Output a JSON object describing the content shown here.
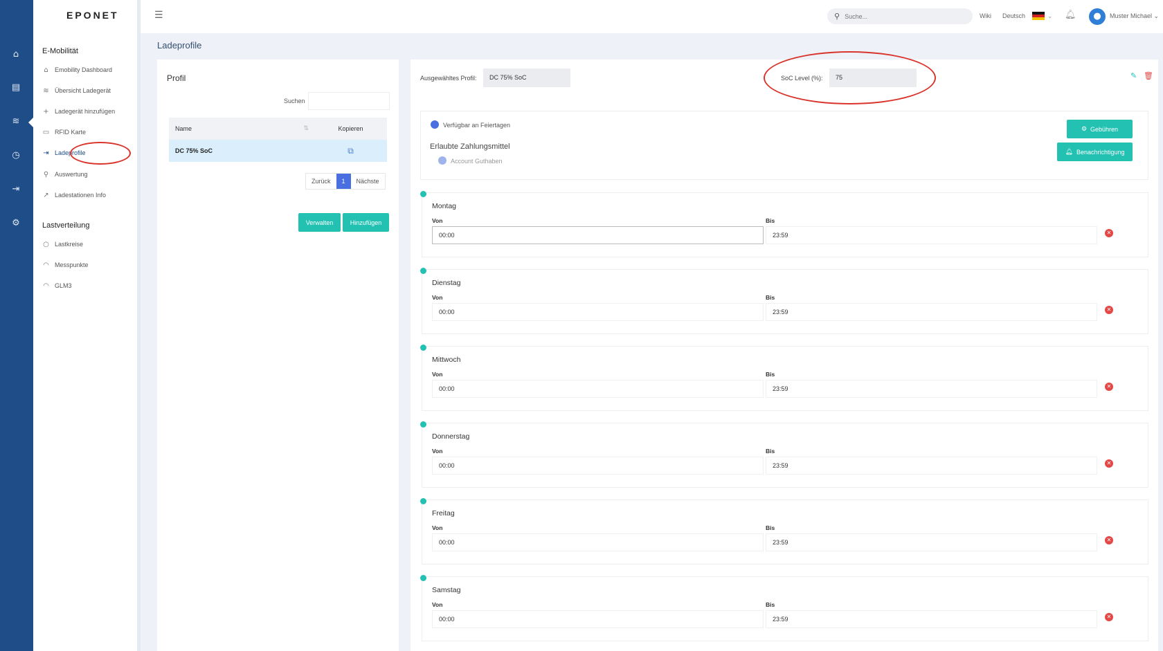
{
  "brand": "EPONET",
  "rail_icons": [
    "home-icon",
    "storage-icon",
    "waves-icon",
    "clock-icon",
    "login-icon",
    "gear-icon"
  ],
  "sidebar": {
    "sections": [
      {
        "title": "E-Mobilität",
        "items": [
          {
            "label": "Emobility Dashboard",
            "icon": "home-icon"
          },
          {
            "label": "Übersicht Ladegerät",
            "icon": "waves-icon"
          },
          {
            "label": "Ladegerät hinzufügen",
            "icon": "plus-icon"
          },
          {
            "label": "RFID Karte",
            "icon": "card-icon"
          },
          {
            "label": "Ladeprofile",
            "icon": "login-icon"
          },
          {
            "label": "Auswertung",
            "icon": "search-icon"
          },
          {
            "label": "Ladestationen Info",
            "icon": "chart-line-icon"
          }
        ]
      },
      {
        "title": "Lastverteilung",
        "items": [
          {
            "label": "Lastkreise",
            "icon": "circle-icon"
          },
          {
            "label": "Messpunkte",
            "icon": "gauge-icon"
          },
          {
            "label": "GLM3",
            "icon": "gauge-icon"
          }
        ]
      }
    ],
    "active_item": "Ladeprofile"
  },
  "topbar": {
    "search_placeholder": "Suche...",
    "wiki": "Wiki",
    "language": "Deutsch",
    "user": "Muster Michael"
  },
  "page_title": "Ladeprofile",
  "profile_card": {
    "title": "Profil",
    "search_label": "Suchen",
    "columns": {
      "name": "Name",
      "copy": "Kopieren"
    },
    "rows": [
      {
        "name": "DC 75% SoC"
      }
    ],
    "pager": {
      "prev": "Zurück",
      "page": "1",
      "next": "Nächste"
    },
    "manage_button": "Verwalten",
    "add_button": "Hinzufügen"
  },
  "detail": {
    "selected_profile_label": "Ausgewähltes Profil:",
    "selected_profile_value": "DC 75% SoC",
    "soc_label": "SoC Level (%):",
    "soc_value": "75",
    "holidays_label": "Verfügbar an Feiertagen",
    "payment_title": "Erlaubte Zahlungsmittel",
    "payment_option": "Account Guthaben",
    "fees_button": "Gebühren",
    "notify_button": "Benachrichtigung",
    "from_label": "Von",
    "to_label": "Bis",
    "days": [
      {
        "name": "Montag",
        "from": "00:00",
        "to": "23:59"
      },
      {
        "name": "Dienstag",
        "from": "00:00",
        "to": "23:59"
      },
      {
        "name": "Mittwoch",
        "from": "00:00",
        "to": "23:59"
      },
      {
        "name": "Donnerstag",
        "from": "00:00",
        "to": "23:59"
      },
      {
        "name": "Freitag",
        "from": "00:00",
        "to": "23:59"
      },
      {
        "name": "Samstag",
        "from": "00:00",
        "to": "23:59"
      }
    ]
  },
  "colors": {
    "rail": "#1e4d88",
    "accent": "#22c1b2",
    "highlight_circle": "#d9342b",
    "delete": "#e54646"
  }
}
